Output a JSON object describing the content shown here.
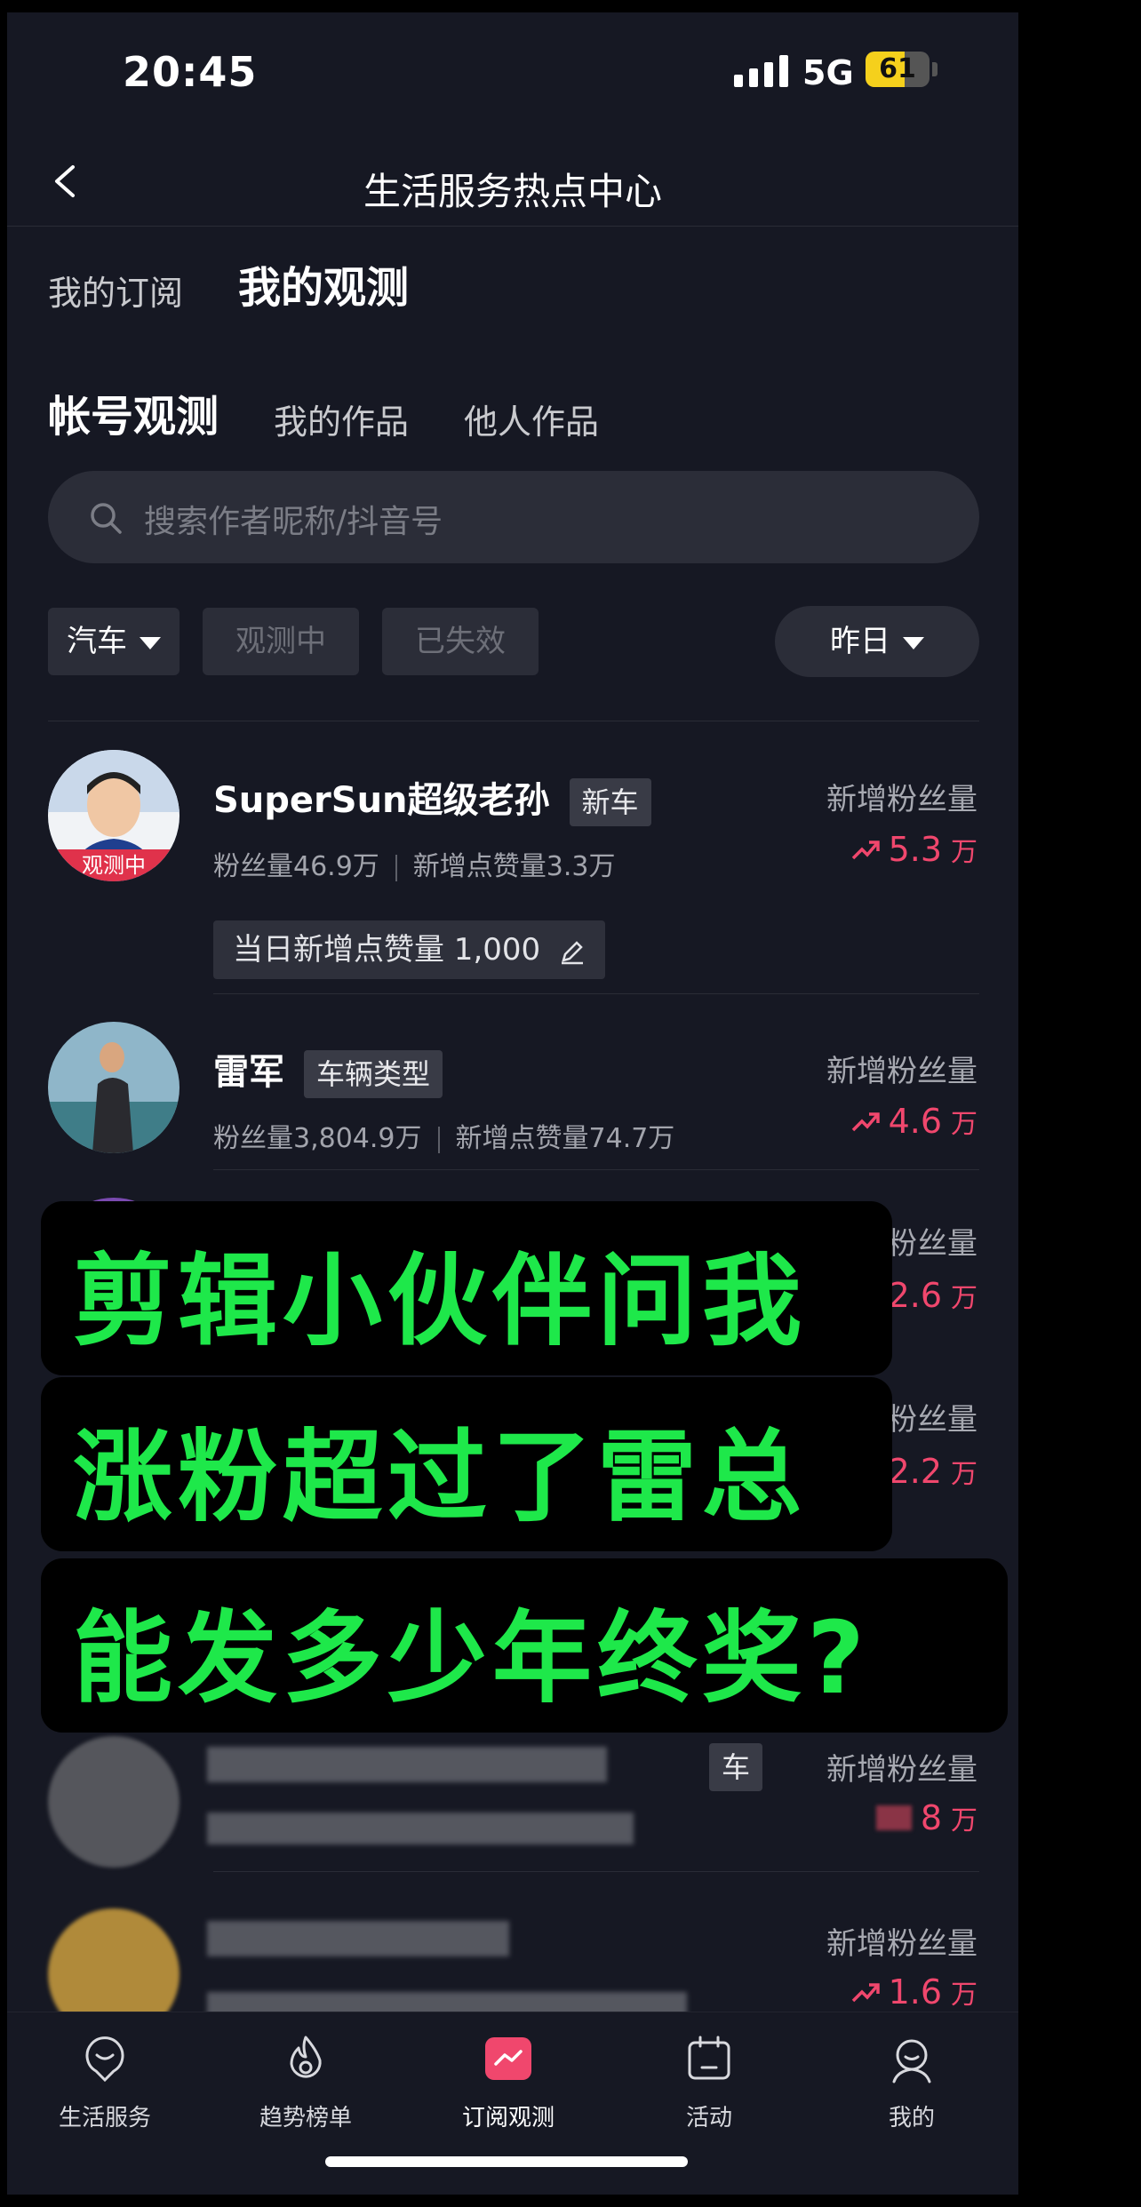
{
  "status_bar": {
    "time": "20:45",
    "network": "5G",
    "battery": "61",
    "battery_level": 0.61
  },
  "header": {
    "title": "生活服务热点中心"
  },
  "top_tabs": {
    "tab1": "我的订阅",
    "tab2": "我的观测"
  },
  "sub_tabs": {
    "tab1": "帐号观测",
    "tab2": "我的作品",
    "tab3": "他人作品"
  },
  "search": {
    "placeholder": "搜索作者昵称/抖音号"
  },
  "filters": {
    "category": "汽车",
    "observing": "观测中",
    "expired": "已失效",
    "date": "昨日"
  },
  "rows": [
    {
      "name": "SuperSun超级老孙",
      "tag": "新车",
      "fans": "粉丝量46.9万",
      "likes": "新增点赞量3.3万",
      "metric_label": "新增粉丝量",
      "metric_value": "5.3",
      "metric_unit": "万",
      "badge": "观测中",
      "daily_like": "当日新增点赞量 1,000"
    },
    {
      "name": "雷军",
      "tag": "车辆类型",
      "fans": "粉丝量3,804.9万",
      "likes": "新增点赞量74.7万",
      "metric_label": "新增粉丝量",
      "metric_value": "4.6",
      "metric_unit": "万"
    },
    {
      "metric_label": "粉丝量",
      "metric_value": "2.6",
      "metric_unit": "万"
    },
    {
      "metric_label": "粉丝量",
      "metric_value": "2.2",
      "metric_unit": "万"
    },
    {
      "tag": "车",
      "metric_label": "新增粉丝量",
      "metric_value": "8",
      "metric_unit": "万"
    },
    {
      "metric_label": "新增粉丝量",
      "metric_value": "1.6",
      "metric_unit": "万"
    }
  ],
  "captions": {
    "line1": "剪辑小伙伴问我",
    "line2": "涨粉超过了雷总",
    "line3": "能发多少年终奖?"
  },
  "tabbar": {
    "t1": "生活服务",
    "t2": "趋势榜单",
    "t3": "订阅观测",
    "t4": "活动",
    "t5": "我的"
  },
  "colors": {
    "background": "#161823",
    "accent_red": "#f0476d",
    "caption_green": "#1ee84a",
    "chip_bg": "#2b2d38"
  }
}
